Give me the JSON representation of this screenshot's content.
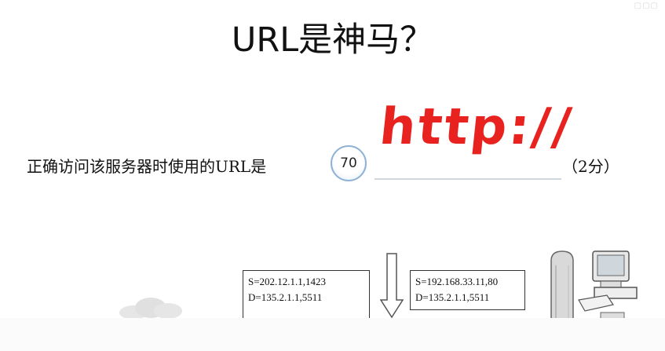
{
  "slide": {
    "title": "URL是神马？",
    "question_text": "正确访问该服务器时使用的URL是",
    "question_number": "70",
    "handwritten_answer": "http://",
    "score_text": "（2分）"
  },
  "diagram": {
    "left_packet": {
      "source": "S=202.12.1.1,1423",
      "dest": "D=135.2.1.1,5511"
    },
    "right_packet": {
      "source": "S=192.168.33.11,80",
      "dest": "D=135.2.1.1,5511"
    }
  },
  "colors": {
    "handwriting": "#e8231f",
    "circle_border": "#8fb3d6",
    "answer_line": "#cfd8de"
  },
  "icons": [
    "cloud-icon",
    "down-arrow-icon",
    "server-icon",
    "computer-icon"
  ]
}
